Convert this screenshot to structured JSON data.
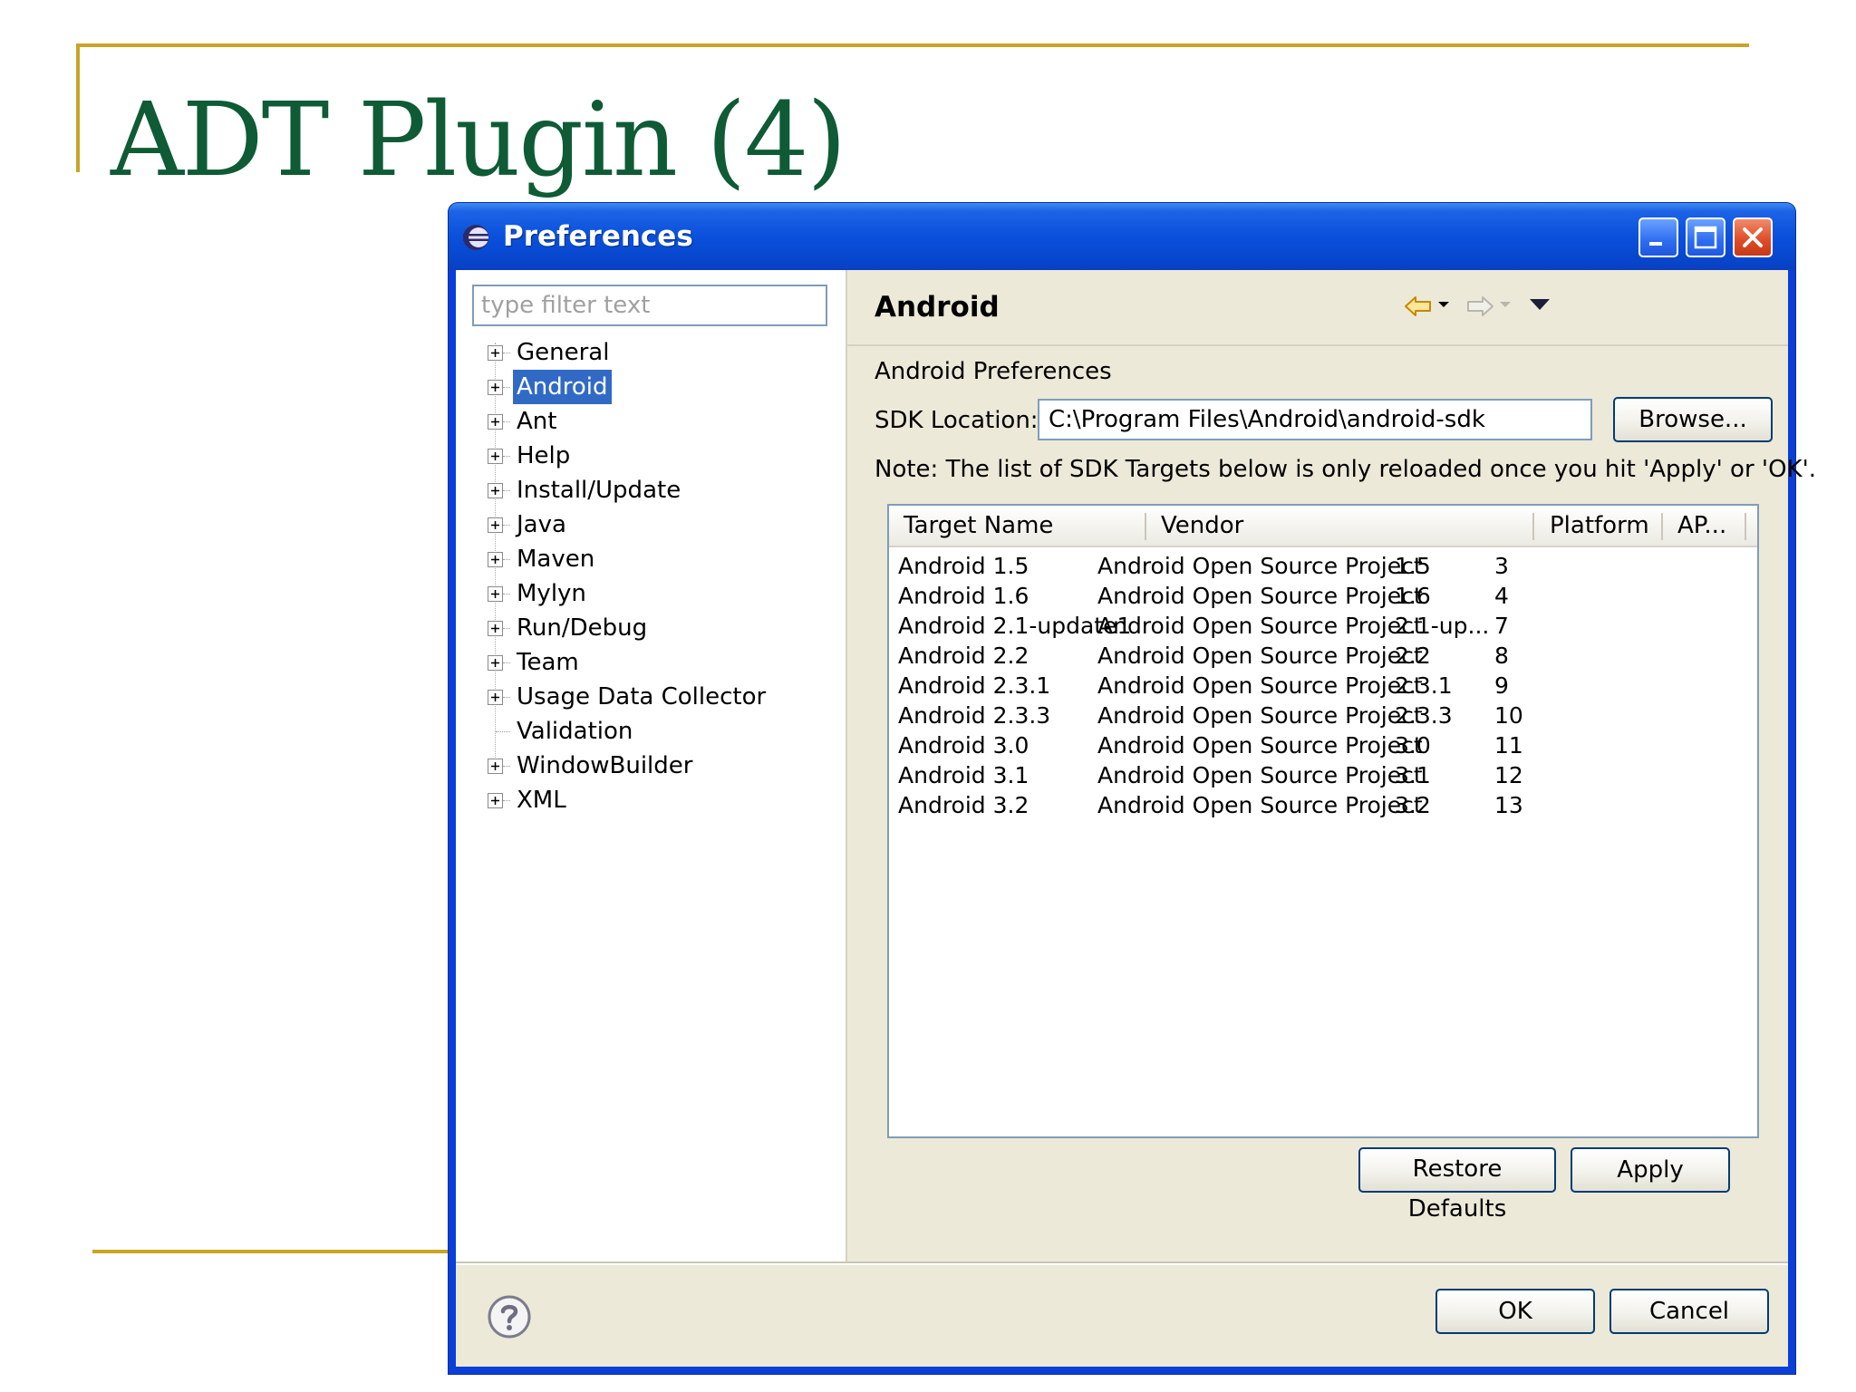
{
  "slide": {
    "title": "ADT Plugin (4)"
  },
  "window": {
    "title": "Preferences",
    "filter_placeholder": "type filter text"
  },
  "tree": {
    "items": [
      {
        "label": "General",
        "expandable": true
      },
      {
        "label": "Android",
        "expandable": true,
        "selected": true
      },
      {
        "label": "Ant",
        "expandable": true
      },
      {
        "label": "Help",
        "expandable": true
      },
      {
        "label": "Install/Update",
        "expandable": true
      },
      {
        "label": "Java",
        "expandable": true
      },
      {
        "label": "Maven",
        "expandable": true
      },
      {
        "label": "Mylyn",
        "expandable": true
      },
      {
        "label": "Run/Debug",
        "expandable": true
      },
      {
        "label": "Team",
        "expandable": true
      },
      {
        "label": "Usage Data Collector",
        "expandable": true
      },
      {
        "label": "Validation",
        "expandable": false
      },
      {
        "label": "WindowBuilder",
        "expandable": true
      },
      {
        "label": "XML",
        "expandable": true
      }
    ]
  },
  "page": {
    "title": "Android",
    "section_label": "Android Preferences",
    "sdk_label": "SDK Location:",
    "sdk_value": "C:\\Program Files\\Android\\android-sdk",
    "browse_label": "Browse...",
    "note": "Note: The list of SDK Targets below is only reloaded once you hit 'Apply' or 'OK'.",
    "restore_label": "Restore Defaults",
    "apply_label": "Apply"
  },
  "table": {
    "headers": [
      "Target Name",
      "Vendor",
      "Platform",
      "AP..."
    ],
    "rows": [
      [
        "Android 1.5",
        "Android Open Source Project",
        "1.5",
        "3"
      ],
      [
        "Android 1.6",
        "Android Open Source Project",
        "1.6",
        "4"
      ],
      [
        "Android 2.1-update1",
        "Android Open Source Project",
        "2.1-up...",
        "7"
      ],
      [
        "Android 2.2",
        "Android Open Source Project",
        "2.2",
        "8"
      ],
      [
        "Android 2.3.1",
        "Android Open Source Project",
        "2.3.1",
        "9"
      ],
      [
        "Android 2.3.3",
        "Android Open Source Project",
        "2.3.3",
        "10"
      ],
      [
        "Android 3.0",
        "Android Open Source Project",
        "3.0",
        "11"
      ],
      [
        "Android 3.1",
        "Android Open Source Project",
        "3.1",
        "12"
      ],
      [
        "Android 3.2",
        "Android Open Source Project",
        "3.2",
        "13"
      ]
    ]
  },
  "footer": {
    "ok_label": "OK",
    "cancel_label": "Cancel"
  },
  "icons": [
    "eclipse-icon",
    "minimize-icon",
    "maximize-icon",
    "close-icon",
    "back-arrow-icon",
    "forward-arrow-icon",
    "menu-dropdown-icon",
    "expand-icon",
    "help-icon"
  ],
  "colors": {
    "title_green": "#0e5b35",
    "rule_gold": "#c9a427",
    "titlebar_blue": "#0a50dc",
    "selection_blue": "#316ac5"
  }
}
